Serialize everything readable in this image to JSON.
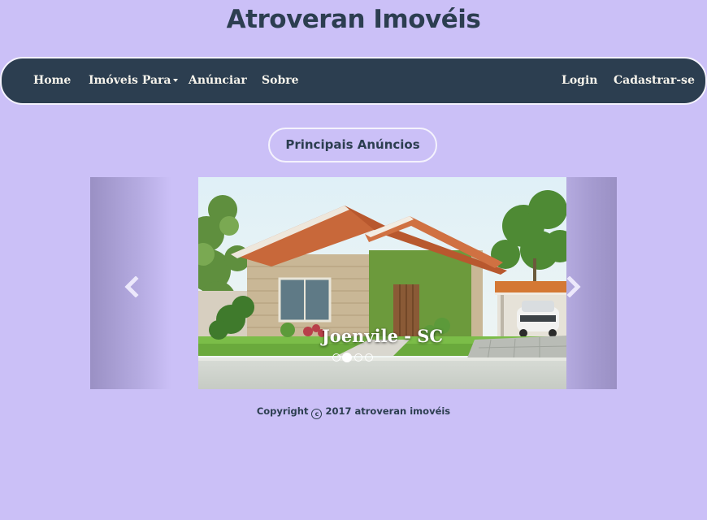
{
  "site": {
    "title": "Atroveran Imovéis"
  },
  "nav": {
    "left": [
      {
        "label": "Home"
      },
      {
        "label": "Imóveis Para",
        "dropdown": true
      },
      {
        "label": "Anúnciar"
      },
      {
        "label": "Sobre"
      }
    ],
    "right": [
      {
        "label": "Login"
      },
      {
        "label": "Cadastrar-se"
      }
    ]
  },
  "main": {
    "section_title": "Principais Anúncios",
    "carousel": {
      "caption": "Joenvile - SC",
      "slide_count": 4,
      "active_index": 1,
      "prev_icon": "chevron-left-icon",
      "next_icon": "chevron-right-icon"
    }
  },
  "footer": {
    "copyright_prefix": "Copyright",
    "copyright_suffix": "2017 atroveran imovéis",
    "copyright_icon": "copyright-icon"
  },
  "colors": {
    "page_background": "#cbc0f7",
    "navbar": "#2c3e50",
    "text_dark": "#2c3e50",
    "nav_text": "#f7f4ec"
  }
}
